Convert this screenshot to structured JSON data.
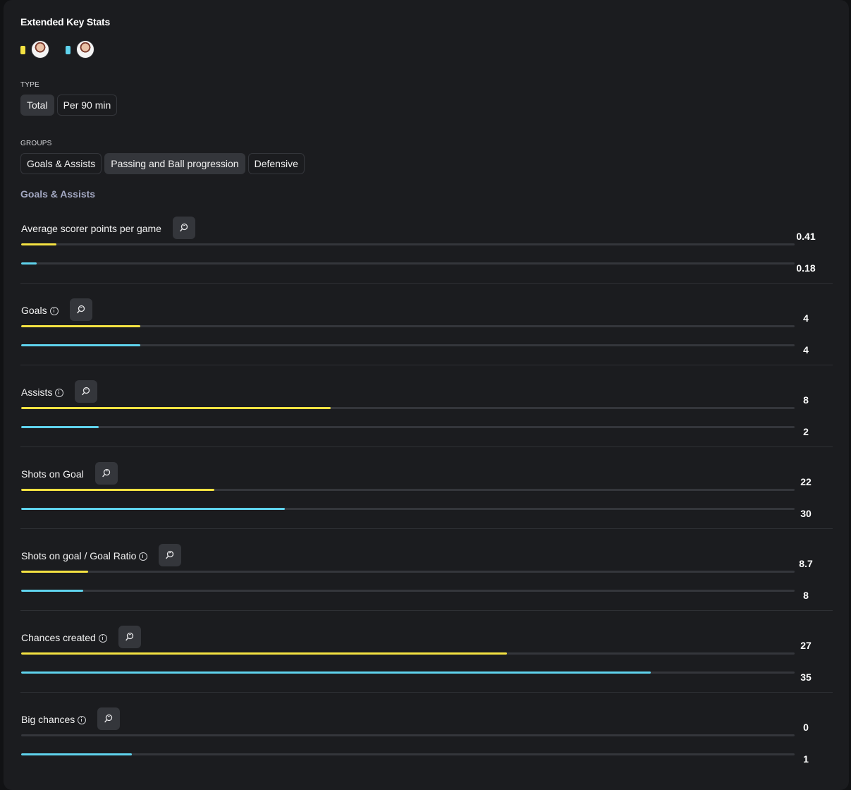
{
  "title": "Extended Key Stats",
  "colors": {
    "player1": "#f4e242",
    "player2": "#5fd3ed"
  },
  "type_filter": {
    "label": "TYPE",
    "options": [
      "Total",
      "Per 90 min"
    ],
    "active": "Total"
  },
  "groups_filter": {
    "label": "GROUPS",
    "options": [
      "Goals & Assists",
      "Passing and Ball progression",
      "Defensive"
    ],
    "active": "Passing and Ball progression"
  },
  "group_heading": "Goals & Assists",
  "stats": [
    {
      "name": "Average scorer points per game",
      "info": false,
      "v1": "0.41",
      "v2": "0.18",
      "f1": 0.046,
      "f2": 0.02
    },
    {
      "name": "Goals",
      "info": true,
      "v1": "4",
      "v2": "4",
      "f1": 0.154,
      "f2": 0.154
    },
    {
      "name": "Assists",
      "info": true,
      "v1": "8",
      "v2": "2",
      "f1": 0.4,
      "f2": 0.1
    },
    {
      "name": "Shots on Goal",
      "info": false,
      "v1": "22",
      "v2": "30",
      "f1": 0.25,
      "f2": 0.341
    },
    {
      "name": "Shots on goal / Goal Ratio",
      "info": true,
      "v1": "8.7",
      "v2": "8",
      "f1": 0.087,
      "f2": 0.08
    },
    {
      "name": "Chances created",
      "info": true,
      "v1": "27",
      "v2": "35",
      "f1": 0.628,
      "f2": 0.814
    },
    {
      "name": "Big chances",
      "info": true,
      "v1": "0",
      "v2": "1",
      "f1": 0.0,
      "f2": 0.143
    }
  ]
}
